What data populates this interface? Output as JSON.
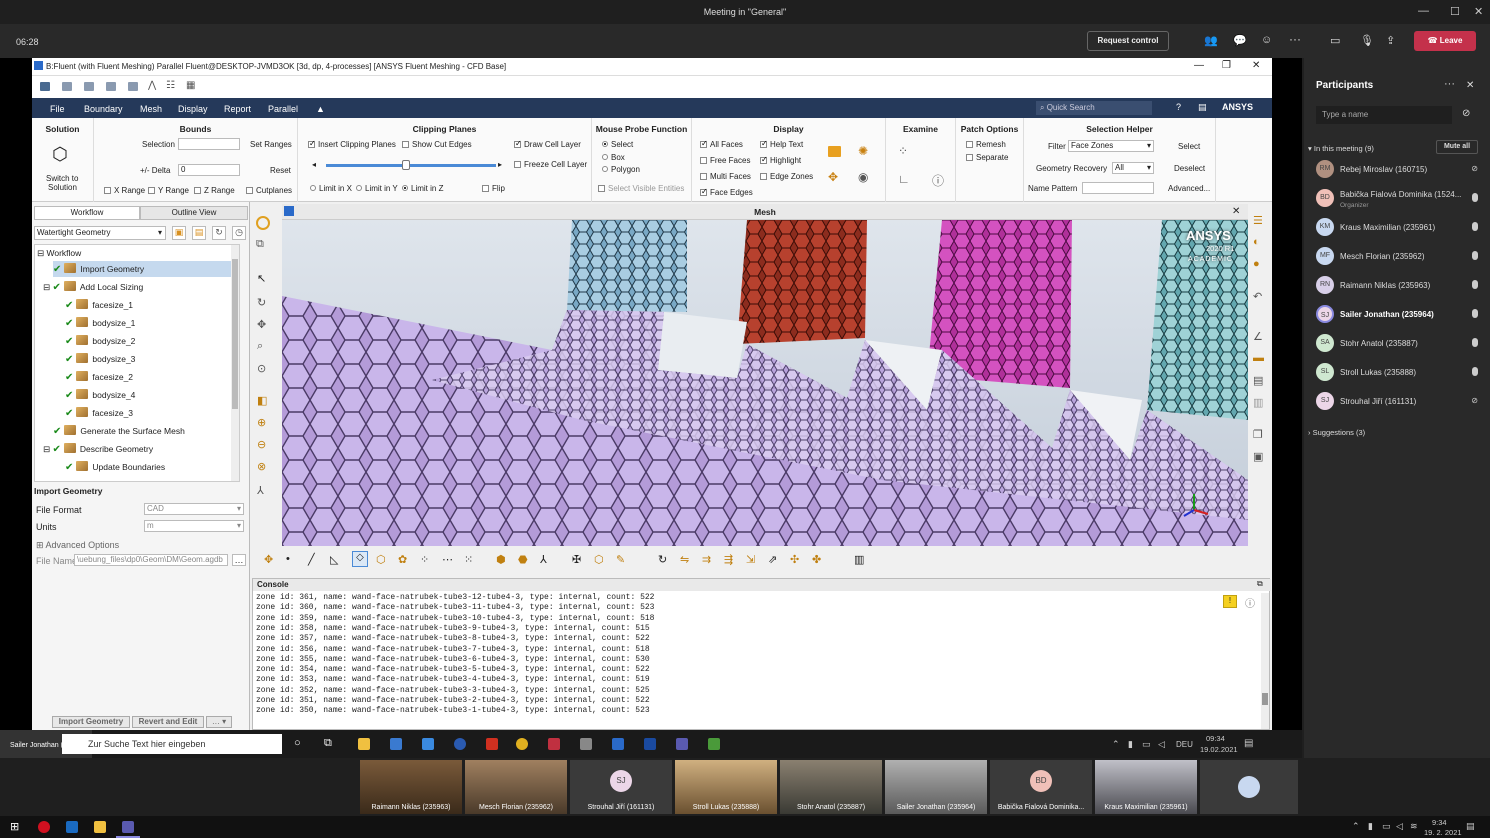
{
  "window": {
    "title": "Meeting in \"General\""
  },
  "meeting": {
    "time": "06:28",
    "request_control": "Request control",
    "leave": "Leave"
  },
  "fluent": {
    "title": "B:Fluent (with Fluent Meshing) Parallel Fluent@DESKTOP-JVMD3OK  [3d, dp, 4-processes] [ANSYS Fluent Meshing - CFD Base]",
    "menu": [
      "File",
      "Boundary",
      "Mesh",
      "Display",
      "Report",
      "Parallel"
    ],
    "search_placeholder": "Quick Search",
    "brand": "ANSYS"
  },
  "ribbon": {
    "solution": {
      "title": "Solution",
      "switch": "Switch to",
      "switch2": "Solution"
    },
    "bounds": {
      "title": "Bounds",
      "selection": "Selection",
      "set_ranges": "Set Ranges",
      "delta": "+/- Delta",
      "delta_value": "0",
      "reset": "Reset",
      "x_range": "X Range",
      "y_range": "Y Range",
      "z_range": "Z Range",
      "cutplanes": "Cutplanes"
    },
    "clipping": {
      "title": "Clipping Planes",
      "insert": "Insert Clipping Planes",
      "show_cut": "Show Cut Edges",
      "draw_cell": "Draw Cell Layer",
      "freeze_cell": "Freeze Cell Layer",
      "limit_x": "Limit in X",
      "limit_y": "Limit in Y",
      "limit_z": "Limit in Z",
      "flip": "Flip"
    },
    "probe": {
      "title": "Mouse Probe Function",
      "select": "Select",
      "box": "Box",
      "polygon": "Polygon",
      "select_visible": "Select Visible Entities"
    },
    "display": {
      "title": "Display",
      "all_faces": "All Faces",
      "help_text": "Help Text",
      "free_faces": "Free Faces",
      "highlight": "Highlight",
      "multi_faces": "Multi Faces",
      "edge_zones": "Edge Zones",
      "face_edges": "Face Edges"
    },
    "examine": {
      "title": "Examine"
    },
    "patch": {
      "title": "Patch Options",
      "remesh": "Remesh",
      "separate": "Separate"
    },
    "helper": {
      "title": "Selection Helper",
      "filter": "Filter",
      "filter_value": "Face Zones",
      "select": "Select",
      "geometry_recovery": "Geometry Recovery",
      "recovery_value": "All",
      "deselect": "Deselect",
      "name_pattern": "Name Pattern",
      "advanced": "Advanced..."
    }
  },
  "left": {
    "tabs": [
      "Workflow",
      "Outline View"
    ],
    "workflow_type": "Watertight Geometry",
    "tree": [
      "Workflow",
      "Import Geometry",
      "Add Local Sizing",
      "facesize_1",
      "bodysize_1",
      "bodysize_2",
      "bodysize_3",
      "facesize_2",
      "bodysize_4",
      "facesize_3",
      "Generate the Surface Mesh",
      "Describe Geometry",
      "Update Boundaries"
    ],
    "panel_title": "Import Geometry",
    "file_format_label": "File Format",
    "file_format_value": "CAD",
    "units_label": "Units",
    "units_value": "m",
    "advanced": "Advanced Options",
    "file_name_label": "File Name",
    "file_name_value": "\\uebung_files\\dp0\\Geom\\DM\\Geom.agdb",
    "btn_import": "Import Geometry",
    "btn_revert": "Revert and Edit"
  },
  "viewport": {
    "title": "Mesh",
    "logo": "ANSYS",
    "logo_year": "2020 R1",
    "logo_sub": "ACADEMIC"
  },
  "console": {
    "title": "Console",
    "lines": [
      "zone id: 361, name: wand-face-natrubek-tube3-12-tube4-3, type: internal, count: 522",
      "zone id: 360, name: wand-face-natrubek-tube3-11-tube4-3, type: internal, count: 523",
      "zone id: 359, name: wand-face-natrubek-tube3-10-tube4-3, type: internal, count: 518",
      "zone id: 358, name: wand-face-natrubek-tube3-9-tube4-3, type: internal, count: 515",
      "zone id: 357, name: wand-face-natrubek-tube3-8-tube4-3, type: internal, count: 522",
      "zone id: 356, name: wand-face-natrubek-tube3-7-tube4-3, type: internal, count: 518",
      "zone id: 355, name: wand-face-natrubek-tube3-6-tube4-3, type: internal, count: 530",
      "zone id: 354, name: wand-face-natrubek-tube3-5-tube4-3, type: internal, count: 522",
      "zone id: 353, name: wand-face-natrubek-tube3-4-tube4-3, type: internal, count: 519",
      "zone id: 352, name: wand-face-natrubek-tube3-3-tube4-3, type: internal, count: 525",
      "zone id: 351, name: wand-face-natrubek-tube3-2-tube4-3, type: internal, count: 522",
      "zone id: 350, name: wand-face-natrubek-tube3-1-tube4-3, type: internal, count: 523"
    ]
  },
  "remote_taskbar": {
    "search": "Zur Suche Text hier eingeben",
    "lang": "DEU",
    "time": "09:34",
    "date": "19.02.2021",
    "presenter": "Sailer Jonathan (235964)"
  },
  "participants": {
    "title": "Participants",
    "search_placeholder": "Type a name",
    "in_meeting": "In this meeting (9)",
    "mute_all": "Mute all",
    "suggestions": "Suggestions (3)",
    "list": [
      {
        "initials": "RM",
        "name": "Rebej Miroslav (160715)",
        "sub": ""
      },
      {
        "initials": "BD",
        "name": "Babička Fialová Dominika (1524...",
        "sub": "Organizer"
      },
      {
        "initials": "KM",
        "name": "Kraus Maximilian (235961)",
        "sub": ""
      },
      {
        "initials": "MF",
        "name": "Mesch Florian (235962)",
        "sub": ""
      },
      {
        "initials": "RN",
        "name": "Raimann Niklas (235963)",
        "sub": ""
      },
      {
        "initials": "SJ",
        "name": "Sailer Jonathan (235964)",
        "sub": ""
      },
      {
        "initials": "SA",
        "name": "Stohr Anatol (235887)",
        "sub": ""
      },
      {
        "initials": "SL",
        "name": "Stroll Lukas (235888)",
        "sub": ""
      },
      {
        "initials": "SJ",
        "name": "Strouhal Jiří (161131)",
        "sub": ""
      }
    ]
  },
  "videos": [
    {
      "name": "Raimann Niklas (235963)",
      "initials": ""
    },
    {
      "name": "Mesch Florian (235962)",
      "initials": ""
    },
    {
      "name": "Strouhal Jiří (161131)",
      "initials": "SJ"
    },
    {
      "name": "Stroll Lukas (235888)",
      "initials": ""
    },
    {
      "name": "Stohr Anatol (235887)",
      "initials": ""
    },
    {
      "name": "Sailer Jonathan (235964)",
      "initials": ""
    },
    {
      "name": "Babička Fialová Dominika...",
      "initials": "BD"
    },
    {
      "name": "Kraus Maximilian (235961)",
      "initials": ""
    }
  ],
  "taskbar": {
    "time": "9:34",
    "date": "19. 2. 2021"
  }
}
